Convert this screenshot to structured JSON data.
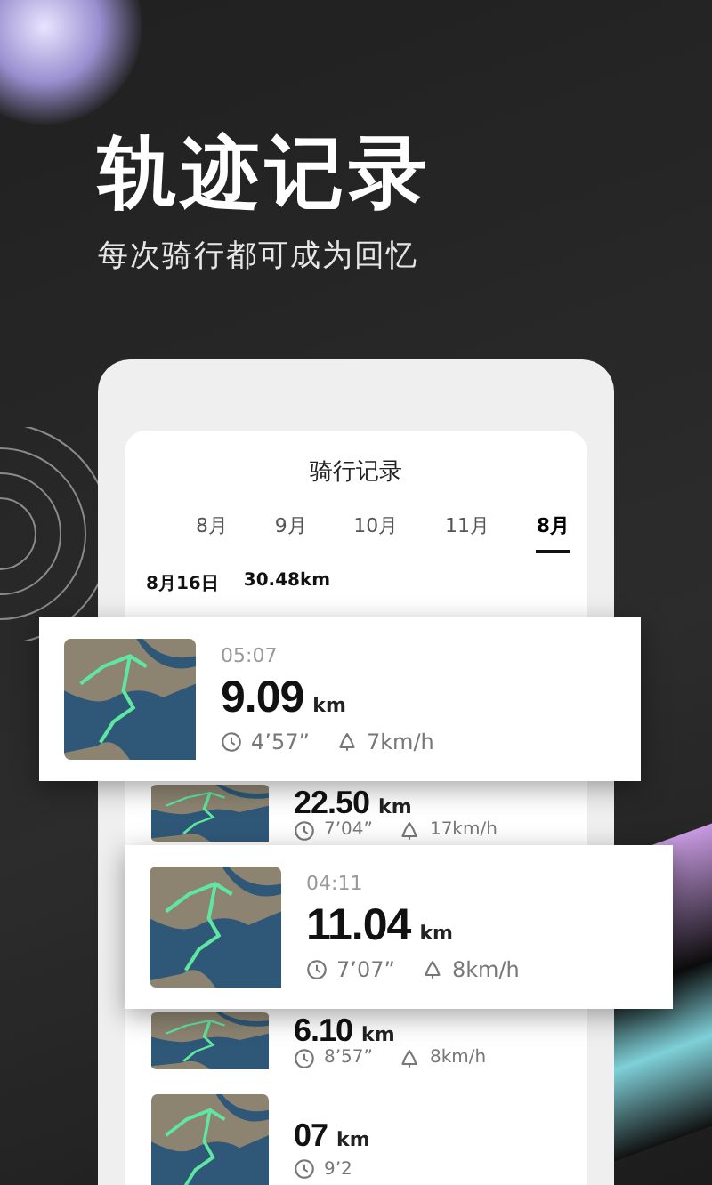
{
  "headline": "轨迹记录",
  "subheadline": "每次骑行都可成为回忆",
  "screen": {
    "title": "骑行记录",
    "month_tabs": [
      {
        "label": "8月",
        "selected": false
      },
      {
        "label": "9月",
        "selected": false
      },
      {
        "label": "10月",
        "selected": false
      },
      {
        "label": "11月",
        "selected": false
      },
      {
        "label": "8月",
        "selected": true
      }
    ],
    "day_summary": {
      "date": "8月16日",
      "total": "30.48km"
    },
    "rides": [
      {
        "kind": "popout",
        "time": "05:07",
        "distance": "9.09",
        "unit": "km",
        "duration": "4’57”",
        "speed": "7km/h"
      },
      {
        "kind": "tucked",
        "distance": "22.50",
        "unit": "km",
        "duration": "7’04”",
        "speed": "17km/h"
      },
      {
        "kind": "popout",
        "time": "04:11",
        "distance": "11.04",
        "unit": "km",
        "duration": "7’07”",
        "speed": "8km/h"
      },
      {
        "kind": "tucked",
        "distance": "6.10",
        "unit": "km",
        "duration": "8’57”",
        "speed": "8km/h"
      },
      {
        "kind": "row",
        "distance": "07",
        "unit": "km",
        "duration": "9’2"
      }
    ]
  }
}
